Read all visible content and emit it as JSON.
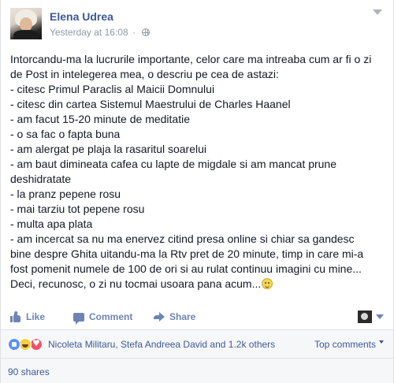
{
  "post": {
    "author": "Elena Udrea",
    "timestamp": "Yesterday at 16:08",
    "separator": "·",
    "privacy_icon": "globe-icon",
    "lines": [
      "Intorcandu-ma la lucrurile importante, celor care ma intreaba cum ar fi o zi",
      "de Post in intelegerea mea, o descriu pe cea de astazi:",
      "- citesc Primul Paraclis al Maicii Domnului",
      "- citesc din cartea Sistemul Maestrului de Charles Haanel",
      "- am facut 15-20 minute de meditatie",
      "- o sa fac o fapta buna",
      "- am alergat pe plaja la rasaritul soarelui",
      "- am baut dimineata cafea cu lapte de migdale si am mancat prune",
      "deshidratate",
      "- la pranz pepene rosu",
      "- mai tarziu tot pepene rosu",
      "- multa apa plata",
      "- am incercat sa nu ma enervez citind presa online si chiar sa gandesc",
      "bine despre Ghita uitandu-ma la Rtv pret de 20 minute, timp in care mi-a",
      "fost pomenit numele de 100 de ori si au rulat continuu imagini cu mine...",
      "Deci, recunosc, o zi nu tocmai usoara pana acum..."
    ],
    "end_emoji": "smiley-emoji"
  },
  "actions": {
    "like_label": "Like",
    "comment_label": "Comment",
    "share_label": "Share"
  },
  "reactions": {
    "types": [
      "like",
      "haha",
      "love"
    ],
    "names": "Nicoleta Militaru, Stefa Andreea David and 1.2k others",
    "sort_label": "Top comments"
  },
  "shares": {
    "label": "90 shares"
  },
  "colors": {
    "link": "#3b5998",
    "action": "#6d84b4",
    "meta": "#9197a3",
    "text": "#141823",
    "footer_bg": "#f6f7f9"
  }
}
